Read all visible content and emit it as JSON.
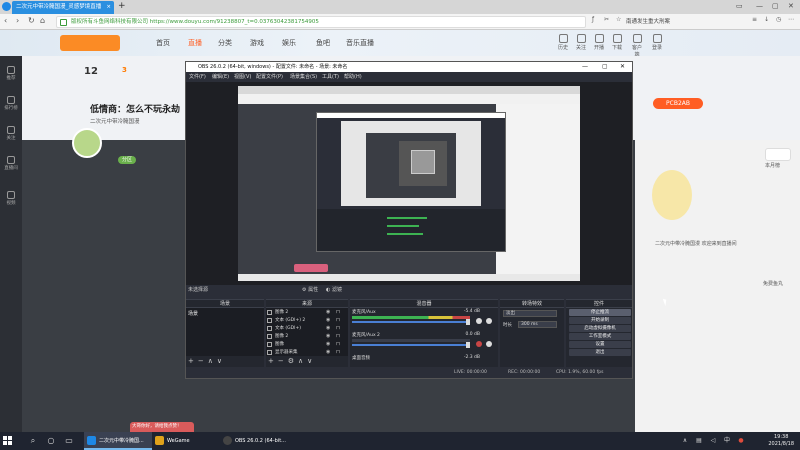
{
  "browser": {
    "tab_title": "二次元中带冷腌国漫_灵感梦境直播",
    "url_site": "版权所有斗鱼网络科技有限公司",
    "url": "https://www.douyu.com/91238807_t=0.03763042381754905",
    "search_text": "南通发生重大刑案"
  },
  "douyu": {
    "nav": [
      "首页",
      "直播",
      "分类",
      "游戏",
      "娱乐",
      "鱼吧",
      "音乐直播"
    ],
    "user_icons": [
      "历史",
      "关注",
      "开播",
      "下载",
      "客户端",
      "登录"
    ],
    "sidebar": [
      "推荐",
      "排行榜",
      "关注",
      "直播间",
      "视频"
    ],
    "stats": {
      "level": "12",
      "fans": "3"
    },
    "room_title": "低情商：怎么不玩永劫",
    "anchor": "二次元中带冷腌国漫",
    "tag": "分区",
    "follow_label": "PCB2AB",
    "right_panel": {
      "notice": "二次元中带冷腌国漫  欢迎来到直播间",
      "rank_label": "本月榜",
      "badge": "免费鱼丸"
    },
    "toast": "大哥你好，请给我点赞！"
  },
  "obs": {
    "title": "OBS 26.0.2 (64-bit, windows) - 配置文件: 未命名 - 场景: 未命名",
    "menu": [
      "文件(F)",
      "编辑(E)",
      "视图(V)",
      "配置文件(P)",
      "场景集合(S)",
      "工具(T)",
      "帮助(H)"
    ],
    "scene_label": "未选择源",
    "properties_label": "属性",
    "filters_label": "滤镜",
    "docks": {
      "scenes": {
        "title": "场景",
        "items": [
          "场景"
        ]
      },
      "sources": {
        "title": "来源",
        "items": [
          "图像 2",
          "文本 (GDI+) 2",
          "文本 (GDI+)",
          "图像 2",
          "图像",
          "显示器采集"
        ]
      },
      "mixer": {
        "title": "混音器",
        "channels": [
          {
            "name": "麦克风/Aux",
            "db": "-5.4 dB"
          },
          {
            "name": "麦克风/Aux 2",
            "db": "0.0 dB"
          },
          {
            "name": "桌面音频",
            "db": "-2.3 dB"
          }
        ]
      },
      "transitions": {
        "title": "转场特效",
        "mode": "淡出",
        "duration_label": "时长",
        "duration": "300 ms"
      },
      "controls": {
        "title": "控件",
        "buttons": [
          "停止推流",
          "开始录制",
          "启动虚拟摄像机",
          "工作室模式",
          "设置",
          "退出"
        ]
      }
    },
    "status": {
      "live": "LIVE: 00:00:00",
      "rec": "REC: 00:00:00",
      "cpu": "CPU: 1.9%, 60.00 fps"
    }
  },
  "taskbar": {
    "apps": [
      "二次元中带冷腌国...",
      "WeGame",
      "OBS 26.0.2 (64-bit..."
    ],
    "time": "19:38",
    "date": "2021/8/18"
  }
}
